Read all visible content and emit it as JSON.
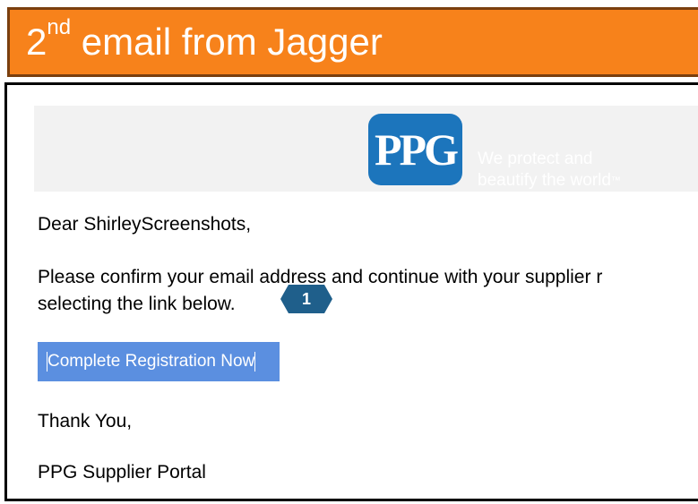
{
  "header": {
    "title_number": "2",
    "title_suffix": "nd",
    "title_rest": " email from Jagger"
  },
  "colors": {
    "header_bg": "#f7821b",
    "logo_blue": "#1c75bc",
    "button_bg": "#5b8fe0",
    "marker": "#1f5f8b"
  },
  "email": {
    "logo_text": "PPG",
    "tagline_line1": "We protect and",
    "tagline_line2": "beautify the world",
    "tagline_mark": "™",
    "greeting": "Dear ShirleyScreenshots,",
    "para_line1": "Please confirm your email address and continue with your supplier r",
    "para_line2": "selecting the link below.",
    "cta_label": "Complete Registration Now",
    "thanks": "Thank You,",
    "signoff": "PPG Supplier Portal"
  },
  "callout": {
    "number": "1"
  }
}
